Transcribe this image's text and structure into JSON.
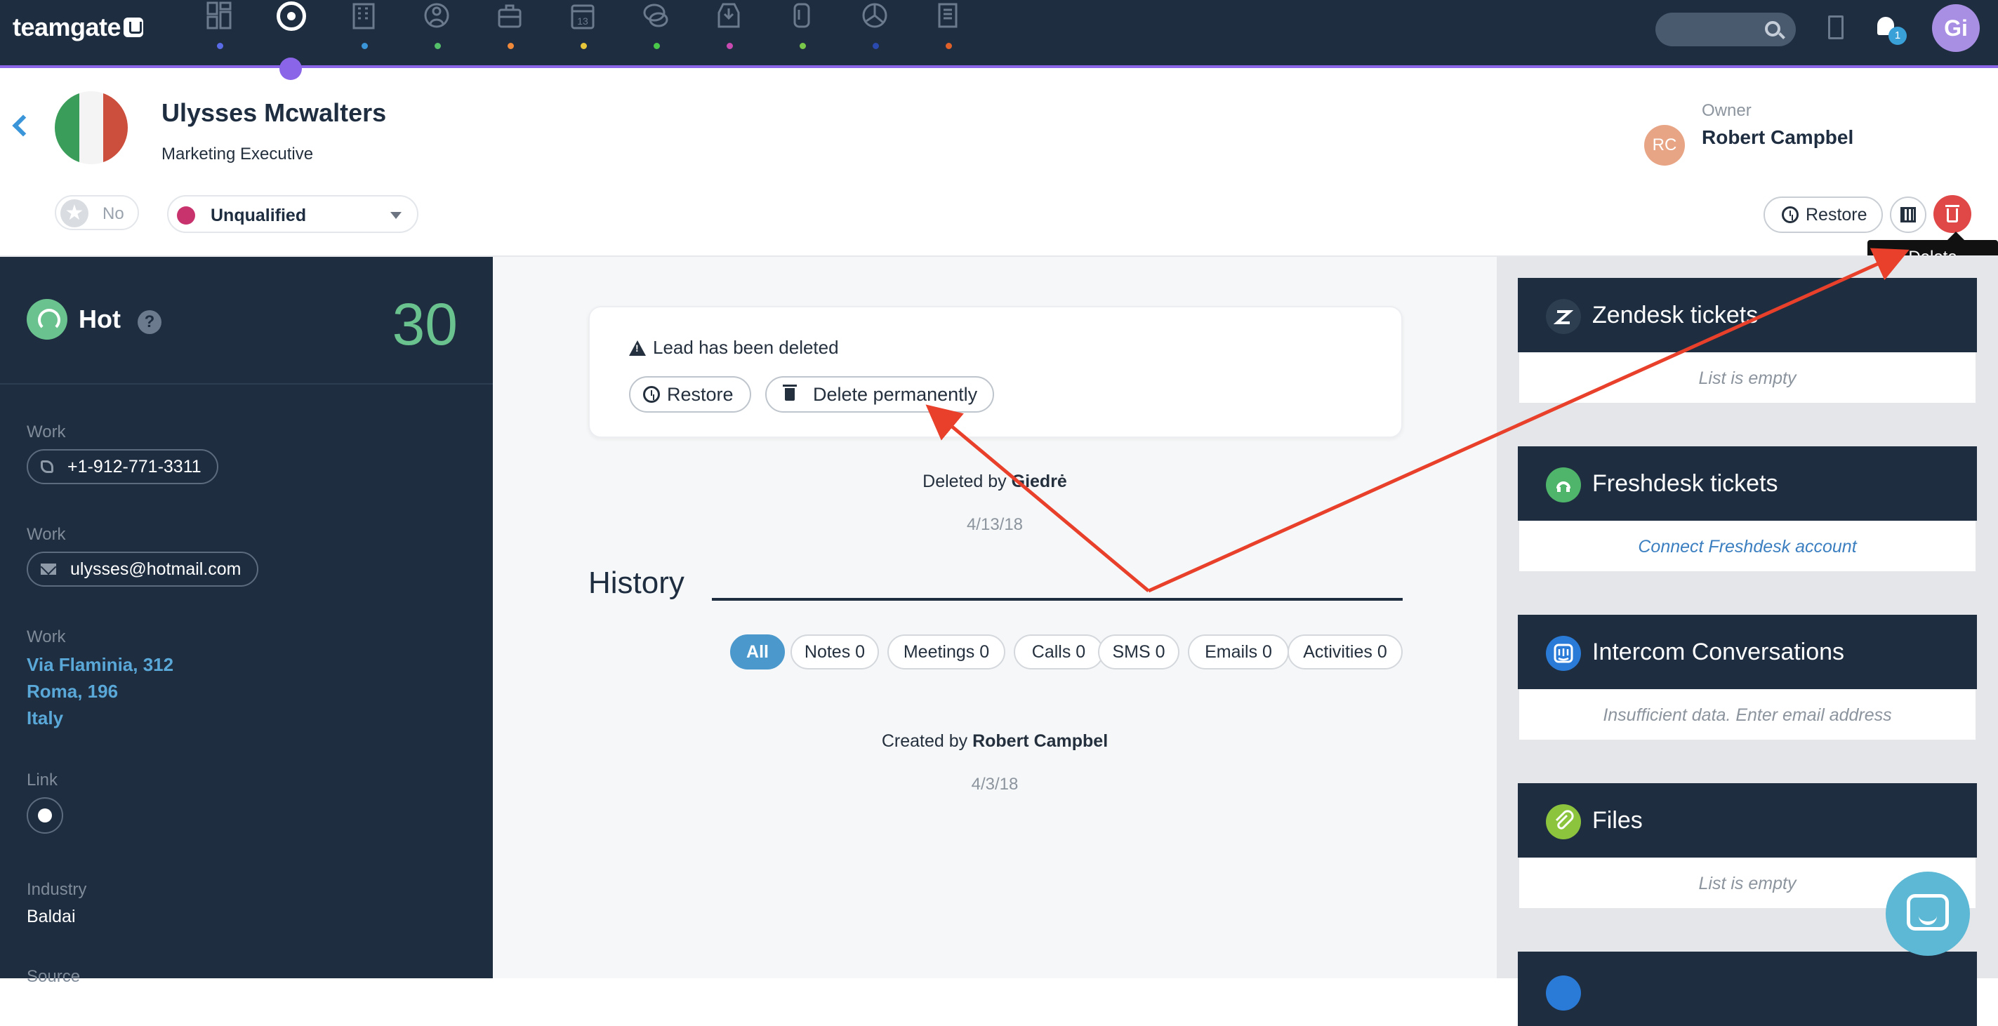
{
  "nav": {
    "logo": "teamgate",
    "icons": [
      {
        "name": "dashboard-icon",
        "dot": "#5a6be8"
      },
      {
        "name": "leads-target-icon",
        "dot": ""
      },
      {
        "name": "companies-building-icon",
        "dot": "#3b95d9"
      },
      {
        "name": "people-icon",
        "dot": "#55c06a"
      },
      {
        "name": "deals-briefcase-icon",
        "dot": "#f08a3a"
      },
      {
        "name": "calendar-icon",
        "dot": "#e8c63a"
      },
      {
        "name": "chat-icon",
        "dot": "#4ac84a"
      },
      {
        "name": "inbox-icon",
        "dot": "#c84ab0"
      },
      {
        "name": "attachment-icon",
        "dot": "#7ac84a"
      },
      {
        "name": "reports-pie-icon",
        "dot": "#2a4ab0"
      },
      {
        "name": "documents-icon",
        "dot": "#e0602a"
      }
    ],
    "calendar_day": "13",
    "notification_count": "1",
    "user_initials": "Gi",
    "accent": "#8a65e8"
  },
  "contact": {
    "name": "Ulysses Mcwalters",
    "title": "Marketing Executive",
    "favorite_label": "No",
    "status": "Unqualified",
    "status_color": "#c8336e",
    "flag_colors": [
      "#3b9d5a",
      "#f4f4f4",
      "#cc4e3c"
    ]
  },
  "owner": {
    "label": "Owner",
    "name": "Robert Campbel",
    "initials": "RC"
  },
  "actions": {
    "restore": "Restore",
    "tooltip": "Delete permanently"
  },
  "score": {
    "label": "Hot",
    "help": "?",
    "value": "30"
  },
  "details": {
    "phone_label": "Work",
    "phone": "+1-912-771-3311",
    "email_label": "Work",
    "email": "ulysses@hotmail.com",
    "address_label": "Work",
    "address_line1": "Via Flaminia, 312",
    "address_line2": "Roma, 196",
    "address_line3": "Italy",
    "link_label": "Link",
    "industry_label": "Industry",
    "industry": "Baldai",
    "source_label": "Source"
  },
  "deleted": {
    "message": "Lead has been deleted",
    "restore": "Restore",
    "delete_permanently": "Delete permanently",
    "by_prefix": "Deleted by",
    "by_name": "Giedrė",
    "date": "4/13/18"
  },
  "history": {
    "title": "History",
    "filters": [
      "All",
      "Notes 0",
      "Meetings 0",
      "Calls 0",
      "SMS 0",
      "Emails 0",
      "Activities 0"
    ],
    "created_prefix": "Created by",
    "created_name": "Robert Campbel",
    "created_date": "4/3/18"
  },
  "widgets": [
    {
      "title": "Zendesk tickets",
      "body": "List is empty",
      "icon": "zendesk-icon",
      "icon_color": "#2c3e50"
    },
    {
      "title": "Freshdesk tickets",
      "body": "Connect Freshdesk account",
      "icon": "freshdesk-icon",
      "icon_color": "#4fb56b"
    },
    {
      "title": "Intercom Conversations",
      "body": "Insufficient data. Enter email address",
      "icon": "intercom-icon",
      "icon_color": "#2a7bd8"
    },
    {
      "title": "Files",
      "body": "List is empty",
      "icon": "paperclip-icon",
      "icon_color": "#8cc43e"
    }
  ]
}
